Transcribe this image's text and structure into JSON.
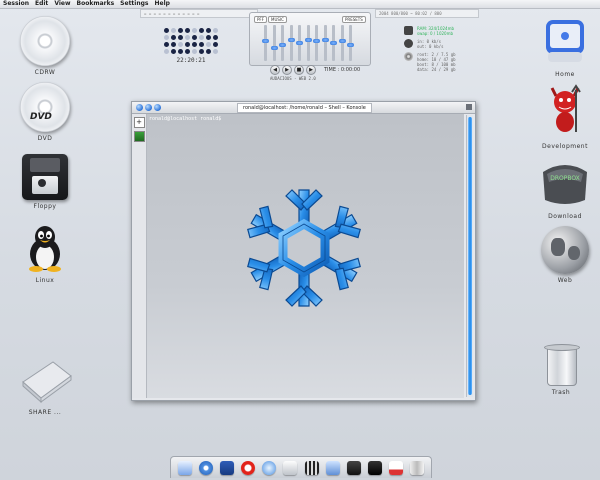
{
  "menubar": {
    "items": [
      "Session",
      "Edit",
      "View",
      "Bookmarks",
      "Settings",
      "Help"
    ]
  },
  "topstrip": {
    "left": "= = = = = = = = = = = =",
    "mid": "2004   800/800   ~   80:02 / 800"
  },
  "desktop_left": [
    {
      "label": "CDRW",
      "icon": "cd-icon"
    },
    {
      "label": "DVD",
      "icon": "dvd-icon"
    },
    {
      "label": "Floppy",
      "icon": "floppy-icon"
    },
    {
      "label": "Linux",
      "icon": "tux-icon"
    },
    {
      "label": "SHARE ...",
      "icon": "share-folder-icon"
    }
  ],
  "desktop_right": [
    {
      "label": "Home",
      "icon": "home-mac-icon"
    },
    {
      "label": "Development",
      "icon": "devil-icon"
    },
    {
      "label": "Download",
      "icon": "dropbox-icon"
    },
    {
      "label": "Web",
      "icon": "globe-icon"
    },
    {
      "label": "Trash",
      "icon": "trash-icon"
    }
  ],
  "clock_widget": {
    "time": "22:20:21"
  },
  "mixer": {
    "buttons": [
      "PFF",
      "MUSIC",
      "PRESETS"
    ],
    "levels": [
      0.55,
      0.35,
      0.45,
      0.6,
      0.5,
      0.6,
      0.55,
      0.6,
      0.5,
      0.55,
      0.45
    ]
  },
  "player": {
    "controls": [
      "prev",
      "play",
      "stop",
      "next"
    ],
    "time_label": "TIME : 0:00:00",
    "caption": "AUDACIOUS - WEB 2.0"
  },
  "sysmon": {
    "ram": "RAM: 324/1024mb",
    "swap": "swap: 0 / 1020mb",
    "net_in": "in: 0 kb/s",
    "net_out": "out: 0 kb/s",
    "disk": [
      "root: 2 / 7.5 gb",
      "home: 18 / 47 gb",
      "boot: 8 / 100 mb",
      "data: 24 / 29 gb"
    ]
  },
  "konsole": {
    "title": "ronald@localhost: /home/ronald – Shell – Konsole",
    "prompt": "ronald@localhost ronald$"
  },
  "dock": {
    "items": [
      "finder-icon",
      "safari-compass-icon",
      "mail-icon",
      "opera-icon",
      "itunes-icon",
      "textedit-icon",
      "film-icon",
      "preview-icon",
      "iphoto-icon",
      "terminal-icon",
      "calendar-icon",
      "trash-dock-icon"
    ]
  },
  "colors": {
    "accent": "#2c73d8",
    "snowflake": "#2a8ee8",
    "terminal_bg": "#c3c7cd"
  }
}
